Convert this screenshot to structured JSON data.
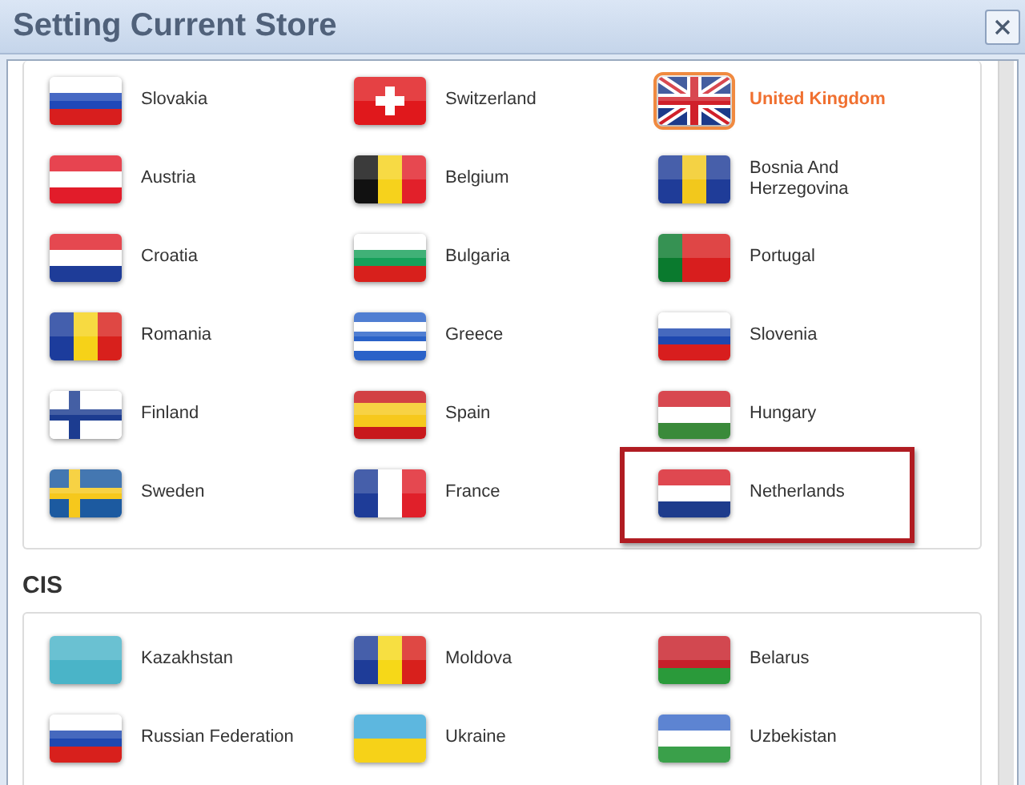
{
  "window": {
    "title": "Setting Current Store"
  },
  "groups": [
    {
      "countries": [
        {
          "name": "Slovakia",
          "selected": false,
          "highlighted": false
        },
        {
          "name": "Switzerland",
          "selected": false,
          "highlighted": false
        },
        {
          "name": "United Kingdom",
          "selected": true,
          "highlighted": false
        },
        {
          "name": "Austria",
          "selected": false,
          "highlighted": false
        },
        {
          "name": "Belgium",
          "selected": false,
          "highlighted": false
        },
        {
          "name": "Bosnia And Herzegovina",
          "selected": false,
          "highlighted": false
        },
        {
          "name": "Croatia",
          "selected": false,
          "highlighted": false
        },
        {
          "name": "Bulgaria",
          "selected": false,
          "highlighted": false
        },
        {
          "name": "Portugal",
          "selected": false,
          "highlighted": false
        },
        {
          "name": "Romania",
          "selected": false,
          "highlighted": false
        },
        {
          "name": "Greece",
          "selected": false,
          "highlighted": false
        },
        {
          "name": "Slovenia",
          "selected": false,
          "highlighted": false
        },
        {
          "name": "Finland",
          "selected": false,
          "highlighted": false
        },
        {
          "name": "Spain",
          "selected": false,
          "highlighted": false
        },
        {
          "name": "Hungary",
          "selected": false,
          "highlighted": false
        },
        {
          "name": "Sweden",
          "selected": false,
          "highlighted": false
        },
        {
          "name": "France",
          "selected": false,
          "highlighted": false
        },
        {
          "name": "Netherlands",
          "selected": false,
          "highlighted": true
        }
      ]
    },
    {
      "title": "CIS",
      "countries": [
        {
          "name": "Kazakhstan",
          "selected": false,
          "highlighted": false
        },
        {
          "name": "Moldova",
          "selected": false,
          "highlighted": false
        },
        {
          "name": "Belarus",
          "selected": false,
          "highlighted": false
        },
        {
          "name": "Russian Federation",
          "selected": false,
          "highlighted": false
        },
        {
          "name": "Ukraine",
          "selected": false,
          "highlighted": false
        },
        {
          "name": "Uzbekistan",
          "selected": false,
          "highlighted": false
        }
      ]
    }
  ]
}
